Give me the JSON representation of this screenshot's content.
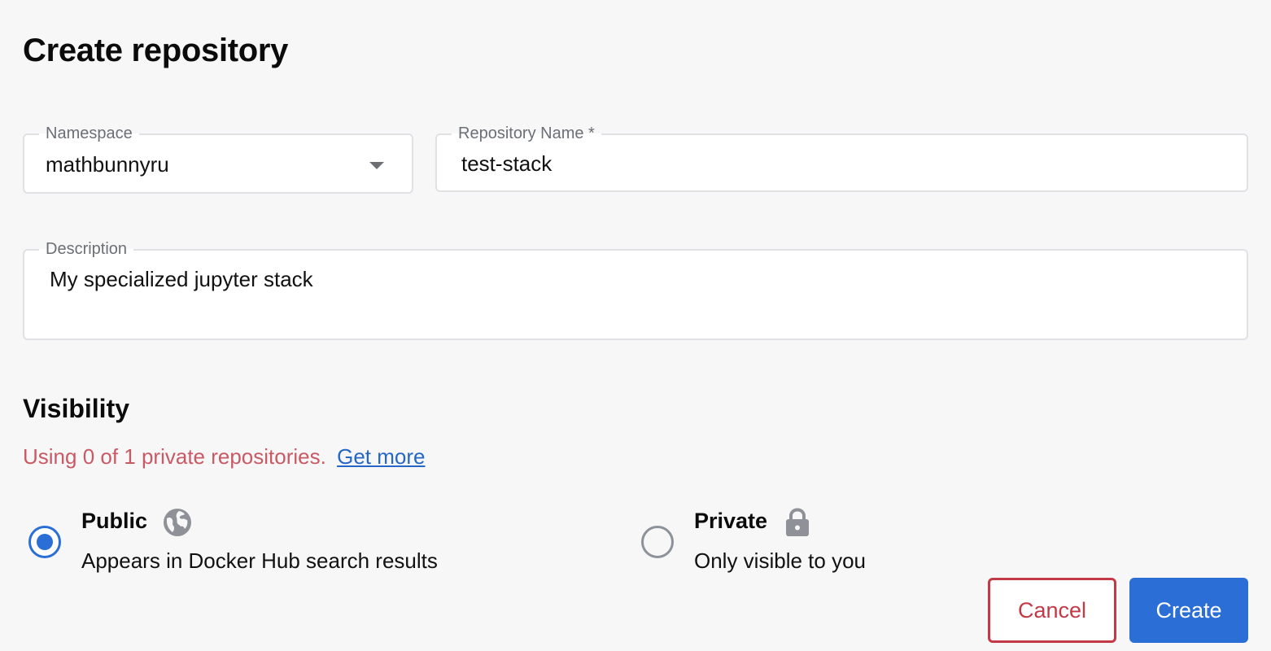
{
  "header": {
    "title": "Create repository"
  },
  "form": {
    "namespace": {
      "label": "Namespace",
      "value": "mathbunnyru"
    },
    "repository_name": {
      "label": "Repository Name *",
      "value": "test-stack"
    },
    "description": {
      "label": "Description",
      "value": "My specialized jupyter stack"
    }
  },
  "visibility": {
    "title": "Visibility",
    "usage_text": "Using 0 of 1 private repositories.",
    "get_more_link": "Get more",
    "options": [
      {
        "title": "Public",
        "description": "Appears in Docker Hub search results",
        "selected": true,
        "icon": "globe-icon"
      },
      {
        "title": "Private",
        "description": "Only visible to you",
        "selected": false,
        "icon": "lock-icon"
      }
    ]
  },
  "actions": {
    "cancel_label": "Cancel",
    "create_label": "Create"
  },
  "colors": {
    "accent": "#2b6fd6",
    "danger": "#c33a46",
    "usage_text": "#c95a64",
    "link": "#2566c7",
    "background": "#f7f7f8"
  }
}
